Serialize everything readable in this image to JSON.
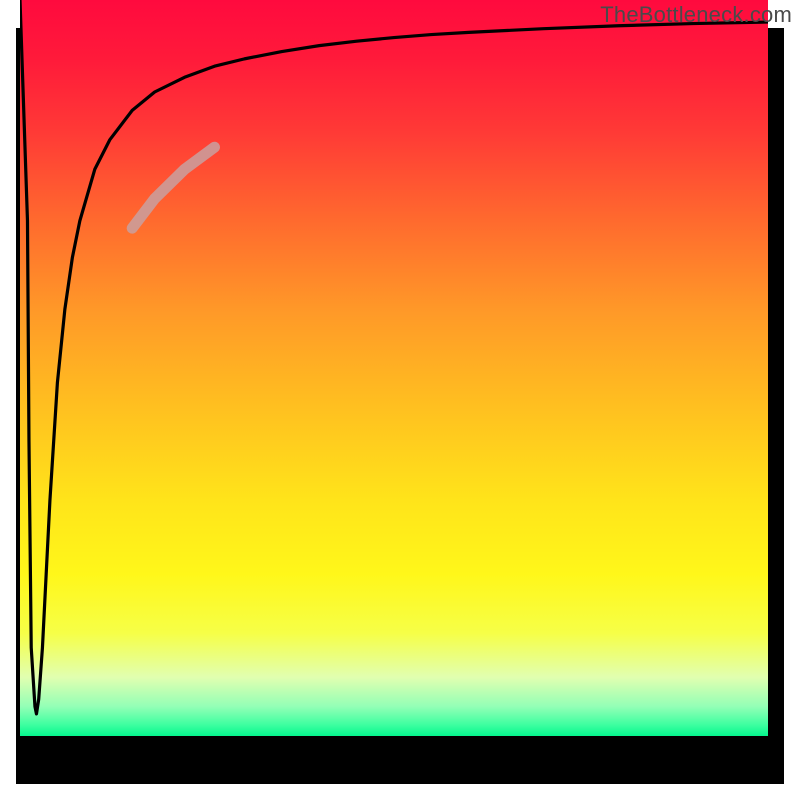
{
  "watermark": "TheBottleneck.com",
  "chart_data": {
    "type": "line",
    "title": "",
    "xlabel": "",
    "ylabel": "",
    "xlim": [
      0,
      100
    ],
    "ylim": [
      0,
      100
    ],
    "grid": false,
    "legend": false,
    "series": [
      {
        "name": "bottleneck-curve",
        "x": [
          0,
          1,
          1.2,
          1.5,
          2,
          2.2,
          2.5,
          3,
          3.5,
          4,
          5,
          6,
          7,
          8,
          10,
          12,
          15,
          18,
          22,
          26,
          30,
          35,
          40,
          45,
          50,
          55,
          60,
          70,
          80,
          90,
          100
        ],
        "y": [
          100,
          70,
          40,
          12,
          4,
          3,
          5,
          12,
          22,
          32,
          48,
          58,
          65,
          70,
          77,
          81,
          85,
          87.5,
          89.5,
          91,
          92,
          93,
          93.8,
          94.4,
          94.9,
          95.3,
          95.6,
          96.1,
          96.5,
          96.8,
          97
        ]
      },
      {
        "name": "highlight-segment",
        "x": [
          15,
          18,
          22,
          26
        ],
        "y": [
          69,
          73,
          77,
          80
        ]
      }
    ],
    "gradient_stops": [
      {
        "pos": 0.0,
        "color": "#ff0a3e"
      },
      {
        "pos": 0.18,
        "color": "#ff3a36"
      },
      {
        "pos": 0.42,
        "color": "#ff9828"
      },
      {
        "pos": 0.68,
        "color": "#ffe41a"
      },
      {
        "pos": 0.86,
        "color": "#f6ff47"
      },
      {
        "pos": 0.96,
        "color": "#93ffb6"
      },
      {
        "pos": 1.0,
        "color": "#05f78e"
      }
    ],
    "highlight_color": "#c9a0a0",
    "curve_color": "#000000"
  }
}
